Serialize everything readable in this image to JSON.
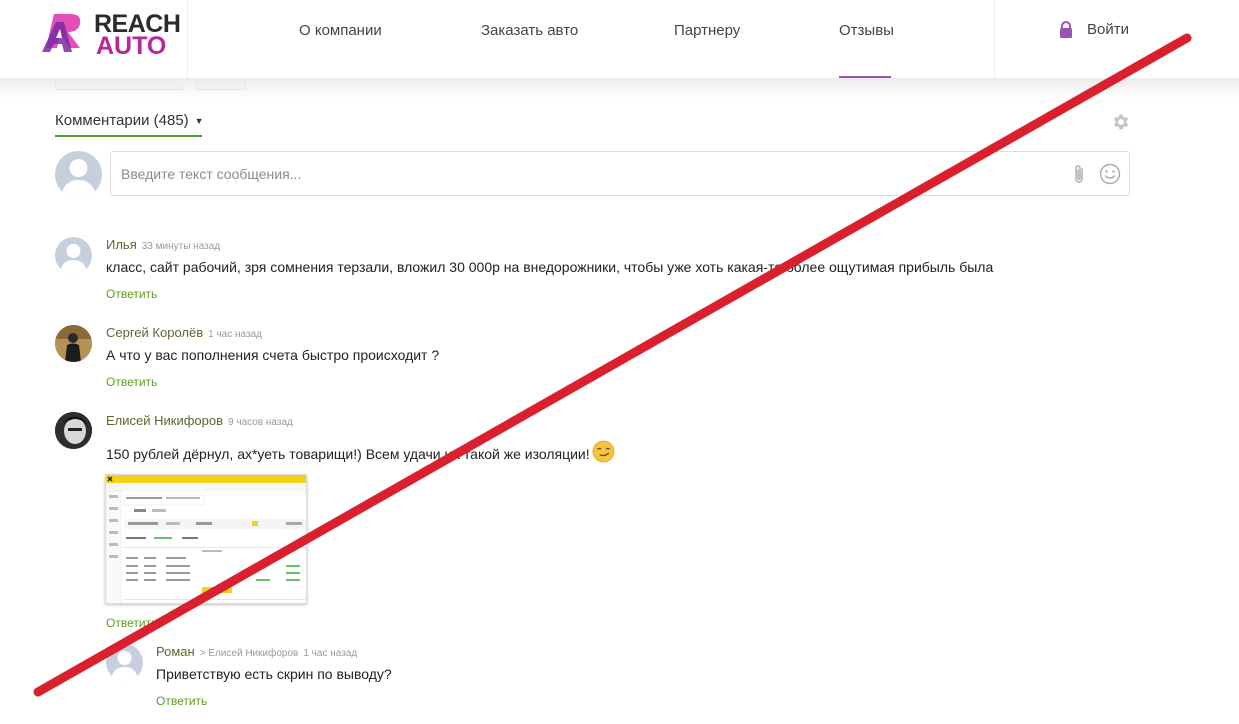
{
  "brand": {
    "line1": "REACH",
    "line2": "AUTO"
  },
  "nav": {
    "items": [
      {
        "label": "О компании"
      },
      {
        "label": "Заказать авто"
      },
      {
        "label": "Партнеру"
      },
      {
        "label": "Отзывы"
      }
    ],
    "active": "Отзывы",
    "login_label": "Войти"
  },
  "comments_header": {
    "label": "Комментарии (485)"
  },
  "composer": {
    "placeholder": "Введите текст сообщения..."
  },
  "reply_label": "Ответить",
  "comments": [
    {
      "author": "Илья",
      "time": "33 минуты назад",
      "text": "класс, сайт рабочий, зря сомнения терзали, вложил 30 000р на внедорожники, чтобы уже хоть какая-то более ощутимая прибыль была"
    },
    {
      "author": "Сергей Королёв",
      "time": "1 час назад",
      "text": "А что у вас пополнения счета быстро происходит ?"
    },
    {
      "author": "Елисей Никифоров",
      "time": "9 часов назад",
      "text": "150 рублей дёрнул, ах*уеть товарищи!) Всем удачи на такой же изоляции!"
    },
    {
      "author": "Роман",
      "reply_to": "> Елисей Никифоров",
      "time": "1 час назад",
      "text": "Приветствую есть скрин по выводу?"
    }
  ],
  "colors": {
    "accent_green": "#5a9e1c",
    "nav_active": "#9b55b8",
    "brand_magenta": "#b8279b",
    "cross_red": "#d9202c"
  }
}
